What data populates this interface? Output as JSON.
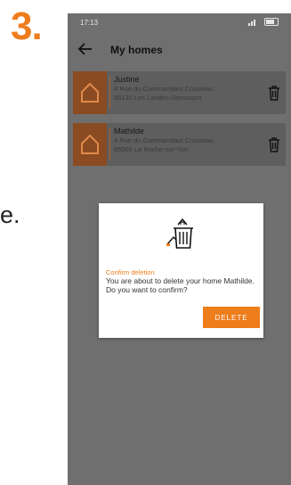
{
  "step": {
    "number": "3."
  },
  "side_text": "e.",
  "status_bar": {
    "time": "17:13"
  },
  "appbar": {
    "title": "My homes"
  },
  "homes": [
    {
      "name": "Justine",
      "address_line1": "4 Rue du Commandant Cousteau",
      "address_line2": "85130 Les Landes-Genusson"
    },
    {
      "name": "Mathilde",
      "address_line1": "4 Rue du Commandant Cousteau",
      "address_line2": "85000 La Roche-sur-Yon"
    }
  ],
  "dialog": {
    "title": "Confirm deletion",
    "message": "You are about to delete your home Mathilde. Do you want to confirm?",
    "delete_label": "DELETE"
  },
  "colors": {
    "accent": "#ee7d1c",
    "overlay": "#6f6f6f",
    "card": "#5e5e5e"
  },
  "icons": [
    "back-arrow-icon",
    "house-icon",
    "trash-icon",
    "delete-home-illustration-icon"
  ]
}
